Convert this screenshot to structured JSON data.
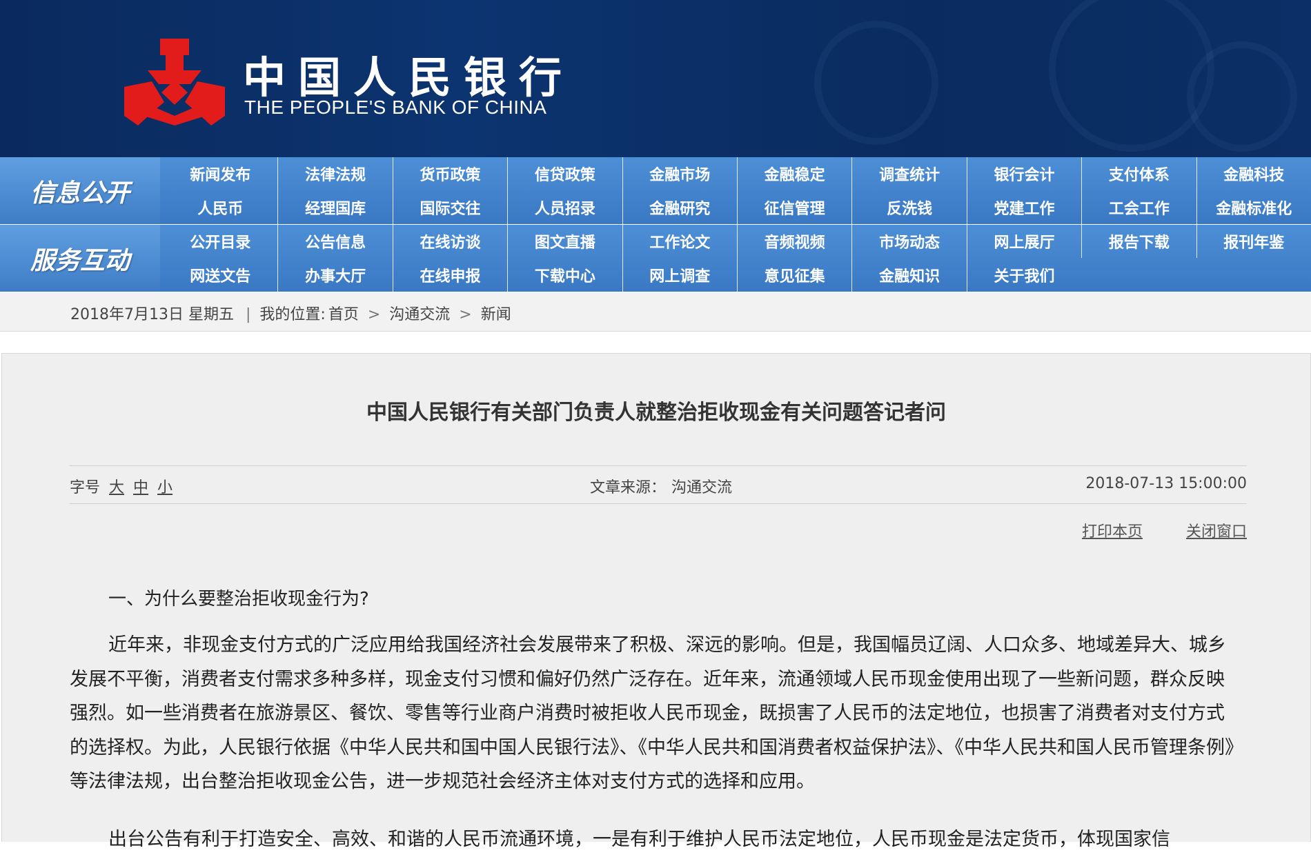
{
  "header": {
    "logo_cn": "中国人民银行",
    "logo_en": "THE PEOPLE'S BANK OF CHINA",
    "emblem_color": "#e21b1b"
  },
  "nav": {
    "section1_label": "信息公开",
    "section2_label": "服务互动",
    "section1_items": [
      "新闻发布",
      "法律法规",
      "货币政策",
      "信贷政策",
      "金融市场",
      "金融稳定",
      "调查统计",
      "银行会计",
      "支付体系",
      "金融科技",
      "人民币",
      "经理国库",
      "国际交往",
      "人员招录",
      "金融研究",
      "征信管理",
      "反洗钱",
      "党建工作",
      "工会工作",
      "金融标准化"
    ],
    "section2_items": [
      "公开目录",
      "公告信息",
      "在线访谈",
      "图文直播",
      "工作论文",
      "音频视频",
      "市场动态",
      "网上展厅",
      "报告下载",
      "报刊年鉴",
      "网送文告",
      "办事大厅",
      "在线申报",
      "下载中心",
      "网上调查",
      "意见征集",
      "金融知识",
      "关于我们"
    ]
  },
  "breadcrumb": {
    "date": "2018年7月13日 星期五",
    "sep": "|",
    "position_label": "我的位置:",
    "home": "首页",
    "arrow": ">",
    "level1": "沟通交流",
    "level2": "新闻"
  },
  "article": {
    "title": "中国人民银行有关部门负责人就整治拒收现金有关问题答记者问",
    "font_size_label": "字号",
    "font_large": "大",
    "font_medium": "中",
    "font_small": "小",
    "source_label": "文章来源：",
    "source": "沟通交流",
    "datetime": "2018-07-13 15:00:00",
    "print": "打印本页",
    "close": "关闭窗口",
    "question1": "一、为什么要整治拒收现金行为?",
    "paragraph1": "近年来，非现金支付方式的广泛应用给我国经济社会发展带来了积极、深远的影响。但是，我国幅员辽阔、人口众多、地域差异大、城乡发展不平衡，消费者支付需求多种多样，现金支付习惯和偏好仍然广泛存在。近年来，流通领域人民币现金使用出现了一些新问题，群众反映强烈。如一些消费者在旅游景区、餐饮、零售等行业商户消费时被拒收人民币现金，既损害了人民币的法定地位，也损害了消费者对支付方式的选择权。为此，人民银行依据《中华人民共和国中国人民银行法》、《中华人民共和国消费者权益保护法》、《中华人民共和国人民币管理条例》等法律法规，出台整治拒收现金公告，进一步规范社会经济主体对支付方式的选择和应用。",
    "paragraph2": "出台公告有利于打造安全、高效、和谐的人民币流通环境，一是有利于维护人民币法定地位，人民币现金是法定货币，体现国家信"
  }
}
